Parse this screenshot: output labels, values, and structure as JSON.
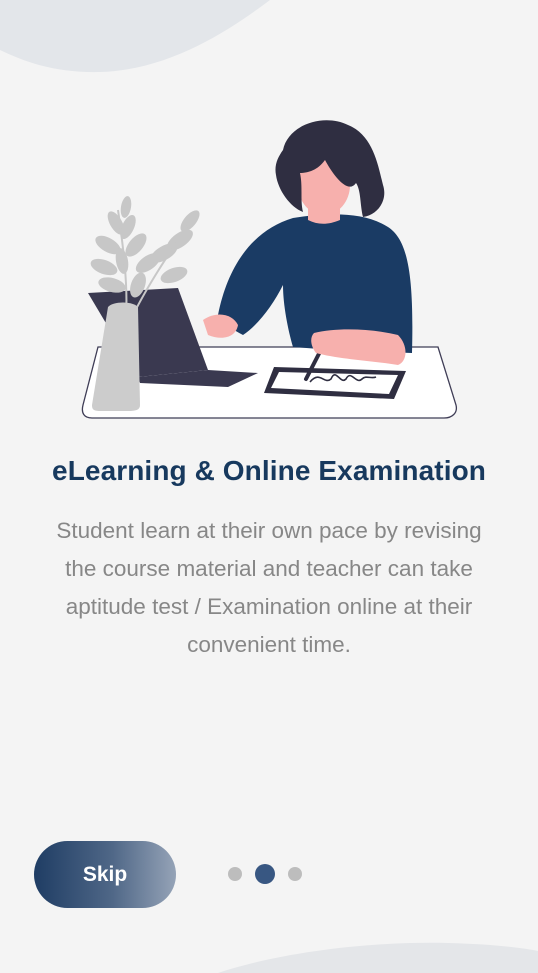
{
  "onboarding": {
    "title": "eLearning & Online Examination",
    "description": "Student learn at their own pace by revising the course material and teacher can take aptitude test / Examination online at their convenient time.",
    "skip_label": "Skip",
    "pager": {
      "total_pages": 3,
      "active_page": 2
    }
  },
  "colors": {
    "primary": "#17395e",
    "text_muted": "#878787",
    "background": "#f4f4f4",
    "dot_active": "#385782",
    "dot_inactive": "#bdbdbd"
  },
  "illustration": {
    "icon": "student-at-desk-illustration"
  }
}
